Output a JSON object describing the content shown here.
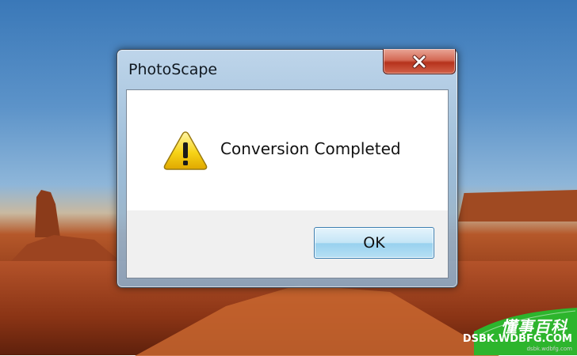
{
  "desktop": {
    "wallpaper": "desert-mesa-wallpaper"
  },
  "dialog": {
    "title": "PhotoScape",
    "close_icon": "close-icon",
    "message_icon": "warning-icon",
    "message": "Conversion Completed",
    "ok_label": "OK"
  },
  "watermark": {
    "brand": "懂事百科",
    "url": "DSBK.WDBFG.COM",
    "sub": "dsbk.wdbfg.com"
  },
  "colors": {
    "accent_green": "#2db52d",
    "close_red": "#c0392b",
    "button_blue": "#3c7fb1"
  }
}
